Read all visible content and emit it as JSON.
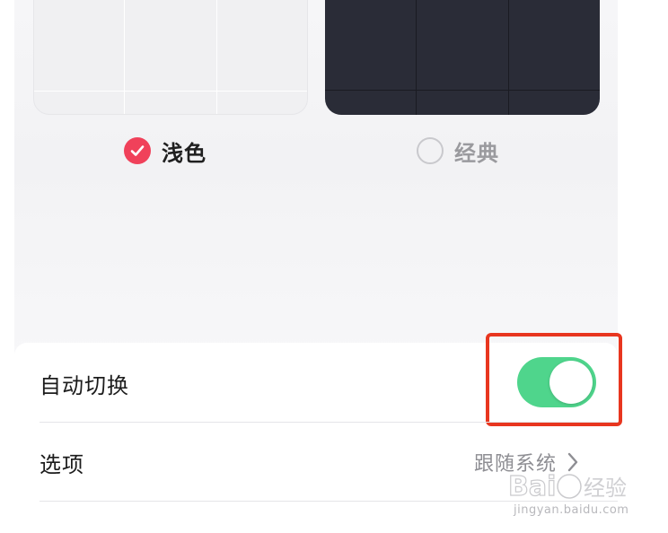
{
  "themes": {
    "light": {
      "label": "浅色",
      "selected": true
    },
    "classic": {
      "label": "经典",
      "selected": false
    }
  },
  "settings": {
    "auto_switch": {
      "label": "自动切换",
      "enabled": true
    },
    "options": {
      "label": "选项",
      "value": "跟随系统"
    }
  },
  "watermark": {
    "brand": "Baidu经验",
    "url": "jingyan.baidu.com"
  },
  "colors": {
    "accent": "#f0415a",
    "toggle_on": "#4fd58c",
    "highlight": "#e8361f",
    "dark_preview": "#2a2c37"
  },
  "icons": {
    "check": "check-icon",
    "chevron": "chevron-right-icon"
  }
}
